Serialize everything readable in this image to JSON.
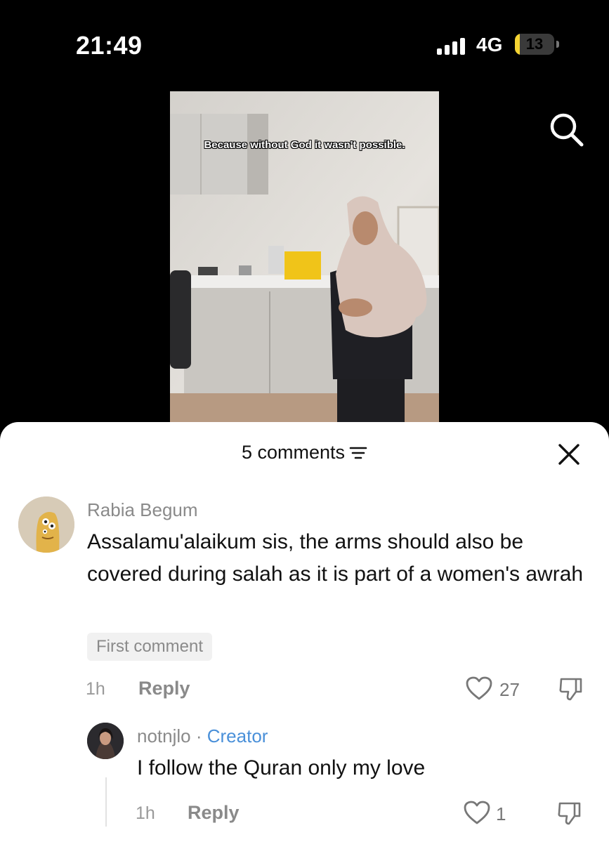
{
  "status_bar": {
    "time": "21:49",
    "network": "4G",
    "battery": "13",
    "battery_level": 0.13
  },
  "video": {
    "caption": "Because without God it wasn't possible."
  },
  "comments_sheet": {
    "count_label": "5 comments",
    "comments": [
      {
        "username": "Rabia Begum",
        "text": "Assalamu'alaikum sis, the arms should also be covered during salah as it is part of a women's awrah",
        "badge": "First comment",
        "time": "1h",
        "reply_label": "Reply",
        "likes": "27"
      }
    ],
    "replies": [
      {
        "username": "notnjlo",
        "separator": " · ",
        "tag": "Creator",
        "text": "I follow the Quran only my love",
        "time": "1h",
        "reply_label": "Reply",
        "likes": "1"
      }
    ]
  },
  "icons": {
    "search": "search-icon",
    "sort": "sort-icon",
    "close": "close-icon",
    "like": "heart-icon",
    "dislike": "thumbs-down-icon"
  }
}
